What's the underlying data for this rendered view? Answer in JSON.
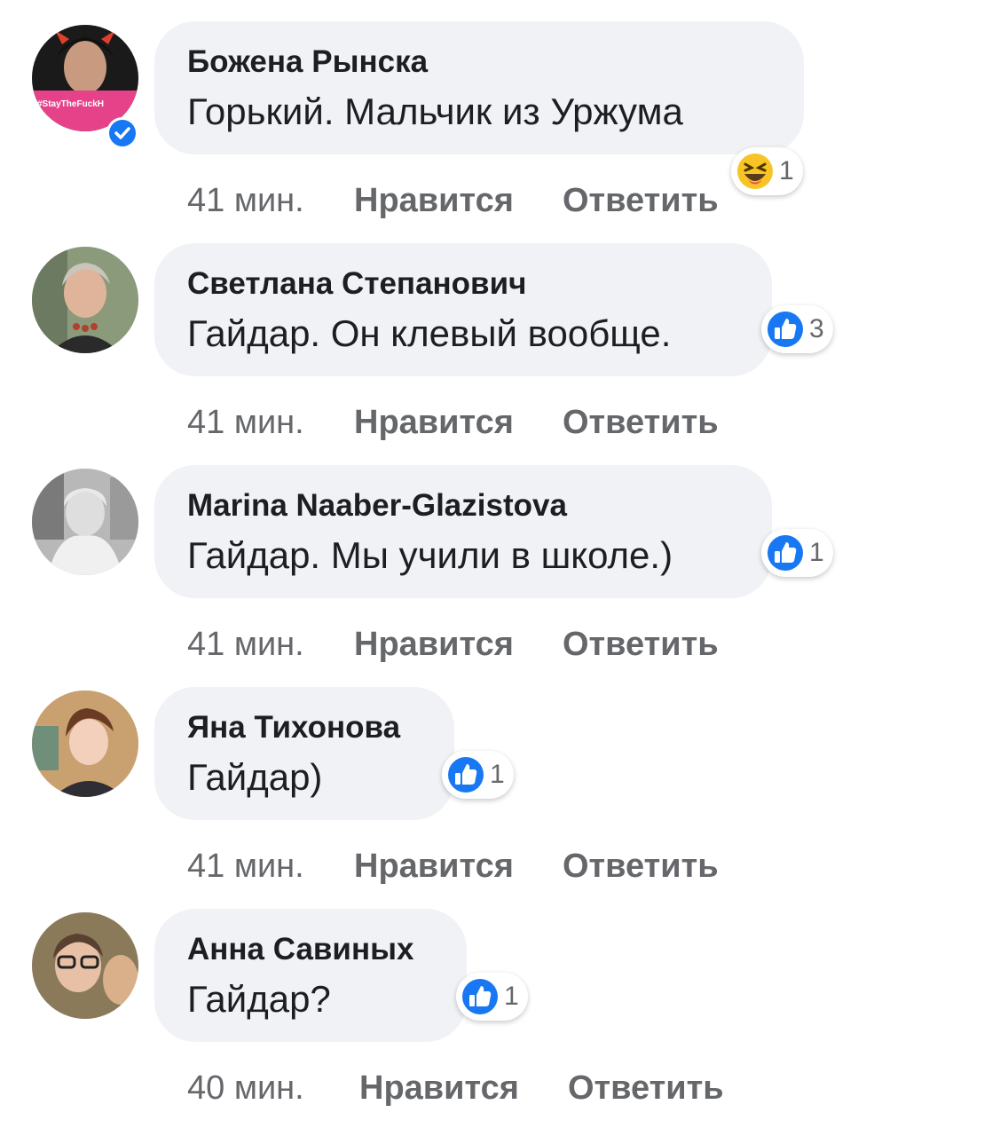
{
  "comments": [
    {
      "author": "Божена Рынска",
      "text": "Горький. Мальчик из Уржума",
      "time": "41 мин.",
      "like_label": "Нравится",
      "reply_label": "Ответить",
      "reaction": {
        "type": "haha",
        "count": "1"
      },
      "avatar_badge": "#StayTheFuckH",
      "verified": true
    },
    {
      "author": "Светлана Степанович",
      "text": "Гайдар. Он клевый вообще.",
      "time": "41 мин.",
      "like_label": "Нравится",
      "reply_label": "Ответить",
      "reaction": {
        "type": "like",
        "count": "3"
      }
    },
    {
      "author": "Marina Naaber-Glazistova",
      "text": "Гайдар. Мы учили в школе.)",
      "time": "41 мин.",
      "like_label": "Нравится",
      "reply_label": "Ответить",
      "reaction": {
        "type": "like",
        "count": "1"
      }
    },
    {
      "author": "Яна Тихонова",
      "text": "Гайдар)",
      "time": "41 мин.",
      "like_label": "Нравится",
      "reply_label": "Ответить",
      "reaction": {
        "type": "like",
        "count": "1"
      }
    },
    {
      "author": "Анна Савиных",
      "text": "Гайдар?",
      "time": "40 мин.",
      "like_label": "Нравится",
      "reply_label": "Ответить",
      "reaction": {
        "type": "like",
        "count": "1"
      }
    }
  ],
  "colors": {
    "bubble": "#f0f2f5",
    "like_blue": "#1877f2",
    "secondary_text": "#65676b",
    "primary_text": "#1c1e21"
  }
}
